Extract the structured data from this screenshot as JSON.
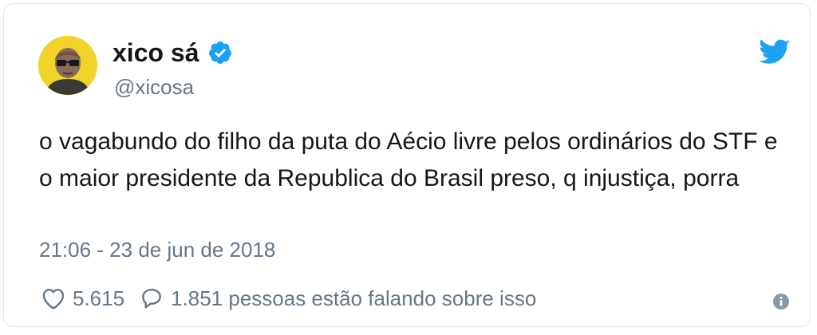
{
  "tweet": {
    "author": {
      "display_name": "xico sá",
      "handle": "@xicosa",
      "verified": true
    },
    "text": "o vagabundo do filho da puta do Aécio livre pelos ordinários do STF e o maior presidente da Republica do Brasil preso, q injustiça, porra",
    "timestamp": "21:06 - 23 de jun de 2018",
    "likes": "5.615",
    "replies_text": "1.851 pessoas estão falando sobre isso"
  },
  "icons": {
    "brand": "twitter-bird-icon",
    "verified": "verified-badge-icon",
    "like": "heart-icon",
    "reply": "speech-bubble-icon",
    "info": "info-icon"
  },
  "colors": {
    "brand": "#1da1f2",
    "text": "#14171a",
    "secondary": "#657786",
    "avatar_bg": "#f1d32a"
  }
}
